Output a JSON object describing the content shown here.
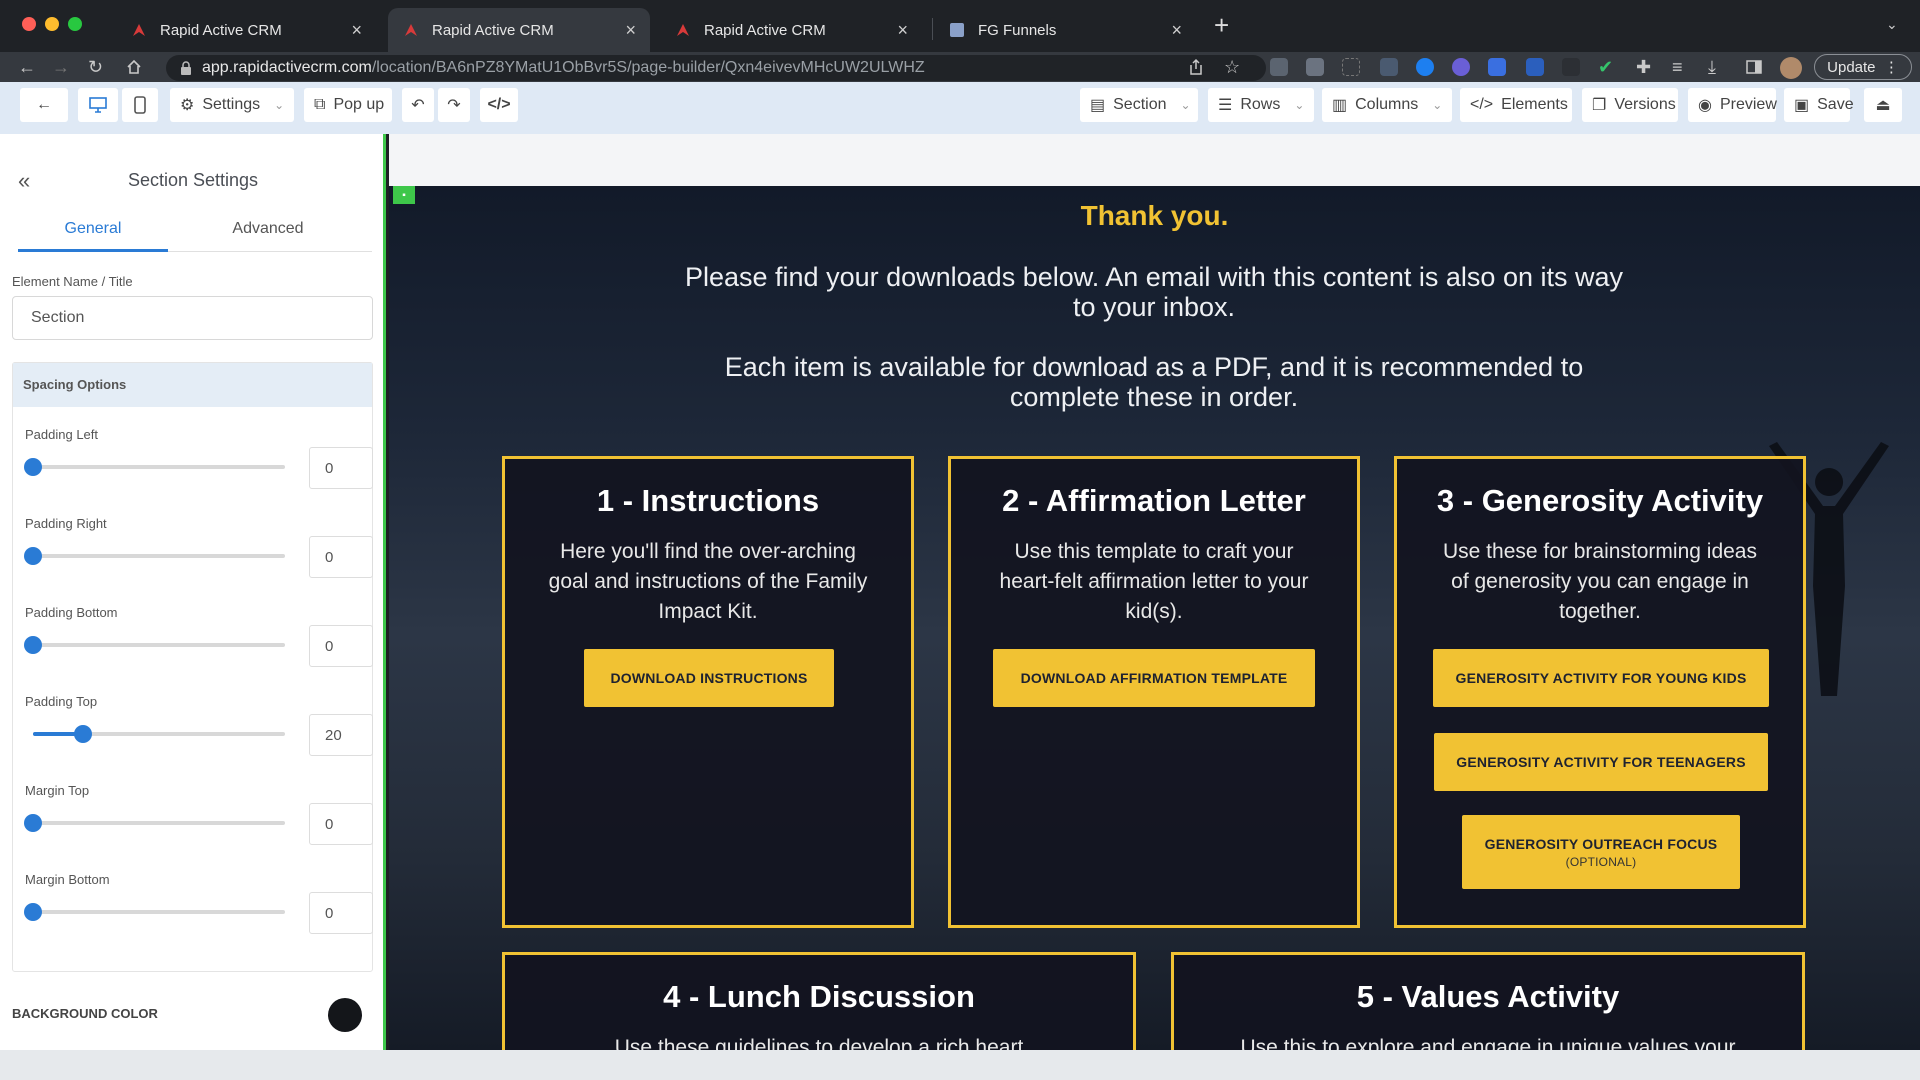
{
  "browser": {
    "tabs": [
      {
        "title": "Rapid Active CRM",
        "active": false
      },
      {
        "title": "Rapid Active CRM",
        "active": true
      },
      {
        "title": "Rapid Active CRM",
        "active": false
      },
      {
        "title": "FG Funnels",
        "active": false
      }
    ],
    "url_domain": "app.rapidactivecrm.com",
    "url_path": "/location/BA6nPZ8YMatU1ObBvr5S/page-builder/Qxn4eivevMHcUW2ULWHZ",
    "update_label": "Update"
  },
  "toolbar": {
    "settings_label": "Settings",
    "popup_label": "Pop up",
    "section_label": "Section",
    "rows_label": "Rows",
    "columns_label": "Columns",
    "elements_label": "Elements",
    "versions_label": "Versions",
    "preview_label": "Preview",
    "save_label": "Save"
  },
  "panel": {
    "title": "Section Settings",
    "tab_general": "General",
    "tab_advanced": "Advanced",
    "element_name_label": "Element Name / Title",
    "element_name_value": "Section",
    "spacing_header": "Spacing Options",
    "sliders": [
      {
        "label": "Padding Left",
        "value": "0",
        "fraction": 0.0
      },
      {
        "label": "Padding Right",
        "value": "0",
        "fraction": 0.0
      },
      {
        "label": "Padding Bottom",
        "value": "0",
        "fraction": 0.0
      },
      {
        "label": "Padding Top",
        "value": "20",
        "fraction": 0.2
      },
      {
        "label": "Margin Top",
        "value": "0",
        "fraction": 0.0
      },
      {
        "label": "Margin Bottom",
        "value": "0",
        "fraction": 0.0
      }
    ],
    "bg_color_label": "BACKGROUND COLOR",
    "bg_color_value": "#14161a"
  },
  "page": {
    "thanks": "Thank you.",
    "para1": "Please find your downloads below. An email with this content is also on its way to your inbox.",
    "para2": "Each item is available for download as a PDF, and it is recommended to complete these in order.",
    "cards": [
      {
        "title": "1 - Instructions",
        "body": "Here you'll find the over-arching goal and instructions of the Family Impact Kit.",
        "buttons": [
          {
            "label": "DOWNLOAD INSTRUCTIONS"
          }
        ]
      },
      {
        "title": "2 - Affirmation Letter",
        "body": "Use this template to craft your heart-felt affirmation letter to your kid(s).",
        "buttons": [
          {
            "label": "DOWNLOAD AFFIRMATION TEMPLATE"
          }
        ]
      },
      {
        "title": "3 - Generosity Activity",
        "body": "Use these for brainstorming ideas of generosity you can engage in together.",
        "buttons": [
          {
            "label": "GENEROSITY ACTIVITY FOR YOUNG KIDS"
          },
          {
            "label": "GENEROSITY ACTIVITY FOR TEENAGERS"
          },
          {
            "label": "GENEROSITY OUTREACH FOCUS",
            "sub": "(OPTIONAL)"
          }
        ]
      },
      {
        "title": "4 - Lunch Discussion",
        "body": "Use these guidelines to develop a rich heart",
        "buttons": []
      },
      {
        "title": "5 - Values Activity",
        "body": "Use this to explore and engage in unique values your",
        "buttons": []
      }
    ]
  },
  "colors": {
    "accent": "#f1c233",
    "selection": "#3ec74a",
    "primary": "#2a7bd5"
  }
}
